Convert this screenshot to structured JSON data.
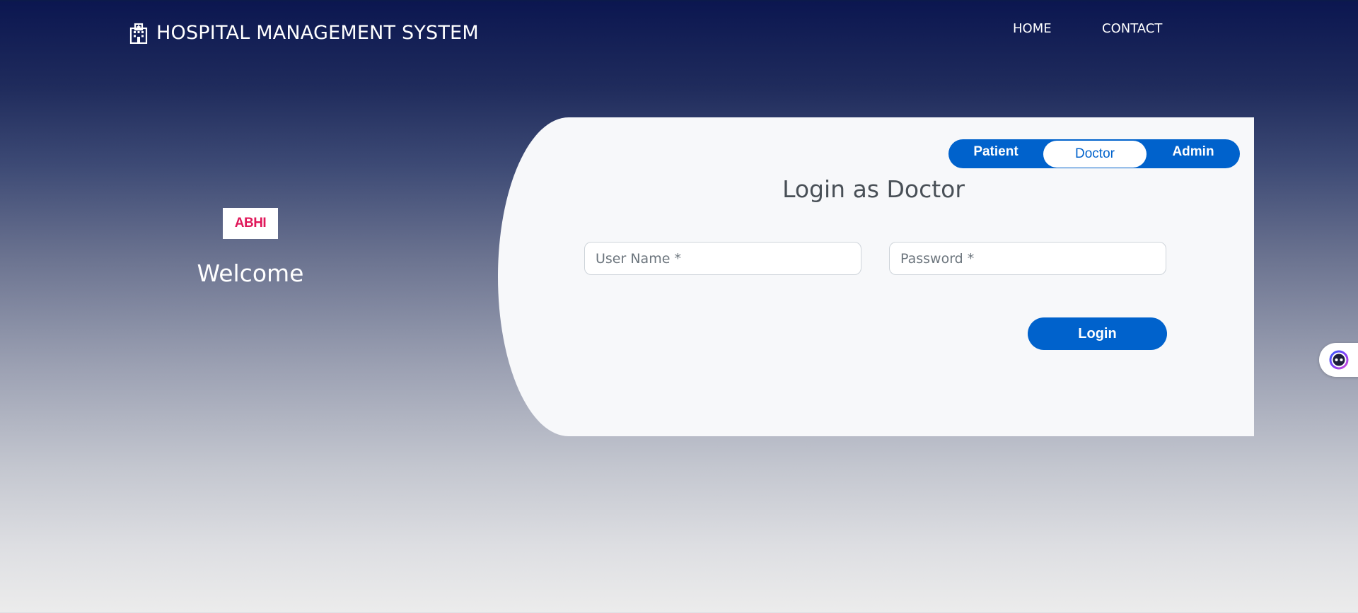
{
  "header": {
    "title": "HOSPITAL MANAGEMENT SYSTEM",
    "brand_icon": "hospital-icon",
    "nav": {
      "home": "HOME",
      "contact": "CONTACT"
    }
  },
  "left_panel": {
    "logo_text": "ABHI",
    "welcome": "Welcome"
  },
  "login_card": {
    "roles": {
      "patient": "Patient",
      "doctor": "Doctor",
      "admin": "Admin",
      "selected": "Doctor"
    },
    "title": "Login as Doctor",
    "username_placeholder": "User Name *",
    "password_placeholder": "Password *",
    "login_button": "Login"
  },
  "colors": {
    "primary": "#0062cc",
    "logo_accent": "#e0185a",
    "header_bg": "#0b1650",
    "card_bg": "#f7f8fa"
  },
  "assistant_widget": {
    "icon": "assistant-bot-icon"
  }
}
